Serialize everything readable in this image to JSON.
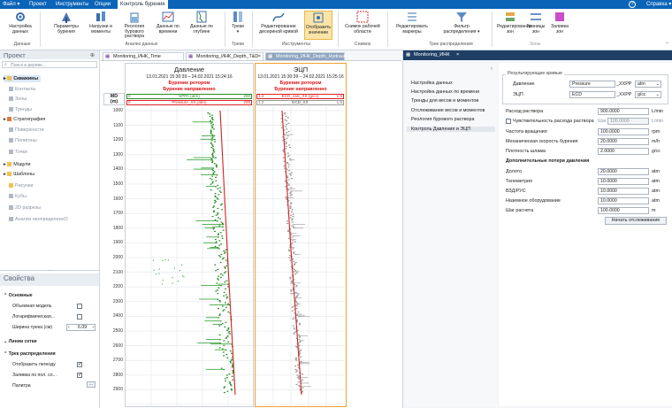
{
  "menubar": {
    "items": [
      "Файл",
      "Проект",
      "Инструменты",
      "Опции",
      "Контроль бурения"
    ],
    "help": "Справка"
  },
  "ribbon": {
    "buttons": [
      {
        "label": "Настройка данных",
        "icon": "gear-icon"
      },
      {
        "label": "Параметры бурения",
        "icon": "drill-icon"
      },
      {
        "label": "Нагрузки и моменты",
        "icon": "loads-icon"
      },
      {
        "label": "Реология бурового раствора",
        "icon": "rheology-icon"
      },
      {
        "label": "Данные по времени",
        "icon": "time-data-icon"
      },
      {
        "label": "Данные по глубине",
        "icon": "depth-data-icon"
      },
      {
        "label": "Треки",
        "icon": "tracks-icon"
      },
      {
        "label": "Редактирование десериной кривой",
        "icon": "curve-edit-icon"
      },
      {
        "label": "Отобразить значение",
        "icon": "show-value-icon"
      },
      {
        "label": "Снимок рабочей области",
        "icon": "snapshot-icon"
      },
      {
        "label": "Редактировать маркеры",
        "icon": "markers-icon"
      },
      {
        "label": "Фильтр распределения",
        "icon": "filter-icon"
      },
      {
        "label": "Редактирование зон",
        "icon": "zones-edit-icon"
      },
      {
        "label": "Границы зон",
        "icon": "zone-bounds-icon"
      },
      {
        "label": "Заливка зон",
        "icon": "zone-fill-icon"
      }
    ],
    "groups": [
      "Данные",
      "Анализ данных",
      "Треки",
      "Инструменты",
      "Снимок",
      "Трек распределения",
      "Зоны"
    ]
  },
  "project": {
    "title": "Проект",
    "search_placeholder": "Поиск в дереве...",
    "tree": [
      {
        "label": "Скважины",
        "style": "bold"
      },
      {
        "label": "Контакты",
        "style": "grey"
      },
      {
        "label": "Зоны",
        "style": "grey"
      },
      {
        "label": "Тренды",
        "style": "grey"
      },
      {
        "label": "Стратиграфия",
        "style": "normal"
      },
      {
        "label": "Поверхности",
        "style": "grey"
      },
      {
        "label": "Полигоны",
        "style": "grey"
      },
      {
        "label": "Точки",
        "style": "grey"
      },
      {
        "label": "Модули",
        "style": "normal"
      },
      {
        "label": "Шаблоны",
        "style": "normal"
      },
      {
        "label": "Рисунки",
        "style": "grey"
      },
      {
        "label": "Кубы",
        "style": "grey"
      },
      {
        "label": "2D разрезы",
        "style": "grey"
      },
      {
        "label": "Анализ неопределеннО",
        "style": "grey"
      }
    ]
  },
  "properties": {
    "title": "Свойства",
    "basic_header": "Основные",
    "volume_model": "Объемная модель",
    "log_scale": "Логарифмическая...",
    "track_width_label": "Ширина трека (см)",
    "track_width_value": "6.09",
    "grid_header": "Линии сетки",
    "dist_header": "Трек распределения",
    "show_legend": "Отобразить легенду",
    "fill_by": "Заливка по пол. со...",
    "palette": "Палитра"
  },
  "tabs": [
    "Monitoring_ИНК_Time",
    "Monitoring_ИНК_Depth_T&D",
    "Monitoring_ИНК_Depth_Hydraulics",
    "Monitoring_ИНК"
  ],
  "tracks": {
    "pressure": {
      "title": "Давление",
      "dates": "13.01.2021 15:30:39 – 24.02.2021 15:24:16",
      "mode1": "Бурение ротором",
      "mode2": "Бурение направленно",
      "curve1": {
        "name": "SPPA (atm)",
        "min": "0",
        "max": "200"
      },
      "curve2": {
        "name": "Pressure_ХХ (atm)",
        "min": "0",
        "max": "200"
      }
    },
    "ecd": {
      "title": "ЭЦП",
      "dates": "13.01.2021 15:30:39 – 24.02.2021 15:25:16",
      "mode1": "Бурение ротором",
      "mode2": "Бурение направленно",
      "curve1": {
        "name": "ECD_calc_ХХ (g/cc)",
        "min": "1.2",
        "max": "1.6"
      },
      "curve2": {
        "name": "ECD_ХХ",
        "min": "1.2",
        "max": "1.6"
      }
    },
    "md_label": "MD",
    "md_unit": "(m)",
    "depth_ticks": [
      "1000",
      "1100",
      "1200",
      "1300",
      "1400",
      "1500",
      "1600",
      "1700",
      "1800",
      "1900",
      "2000",
      "2100",
      "2200",
      "2300",
      "2400",
      "2500",
      "2600",
      "2700",
      "2800",
      "2900"
    ]
  },
  "right": {
    "tab": "Monitoring_ИНК",
    "nav": [
      "Настройка данных",
      "Настройка данных по времени",
      "Тренды для весов и моментов",
      "Отслеживание весов и моментов",
      "Реология бурового раствора",
      "Контроль Давления и ЭЦП"
    ],
    "curves_header": "Результирующие кривые",
    "pressure_label": "Давление",
    "pressure_curve": "Pressure",
    "pressure_suffix": "_ХХРР",
    "pressure_unit": "atm",
    "ecd_label": "ЭЦП",
    "ecd_curve": "ECD",
    "ecd_suffix": "_ХХРР",
    "ecd_unit": "g/cc",
    "flow_label": "Расход раствора",
    "flow_value": "900.0000",
    "flow_unit": "L/min",
    "sens_label": "Чувствительность расхода раствора",
    "step_label": "Шаг",
    "step_value": "100.0000",
    "step_unit": "L/min",
    "rpm_label": "Частота вращения",
    "rpm_value": "100.0000",
    "rpm_unit": "rpm",
    "rop_label": "Механическая скорость бурения",
    "rop_value": "20.0000",
    "rop_unit": "m/h",
    "dens_label": "Плотность шлама",
    "dens_value": "2.0000",
    "dens_unit": "g/cc",
    "extra_header": "Дополнительные потери давления",
    "bit_label": "Долото",
    "bit_value": "20.0000",
    "bit_unit": "atm",
    "tele_label": "Телеметрия",
    "tele_value": "10.0000",
    "tele_unit": "atm",
    "vzd_label": "ВЗД/РУС",
    "vzd_value": "10.0000",
    "vzd_unit": "atm",
    "surf_label": "Наземное оборудование",
    "surf_value": "10.0000",
    "surf_unit": "atm",
    "calcstep_label": "Шаг расчета",
    "calcstep_value": "100.0000",
    "calcstep_unit": "m",
    "start_button": "Начать отслеживание"
  }
}
